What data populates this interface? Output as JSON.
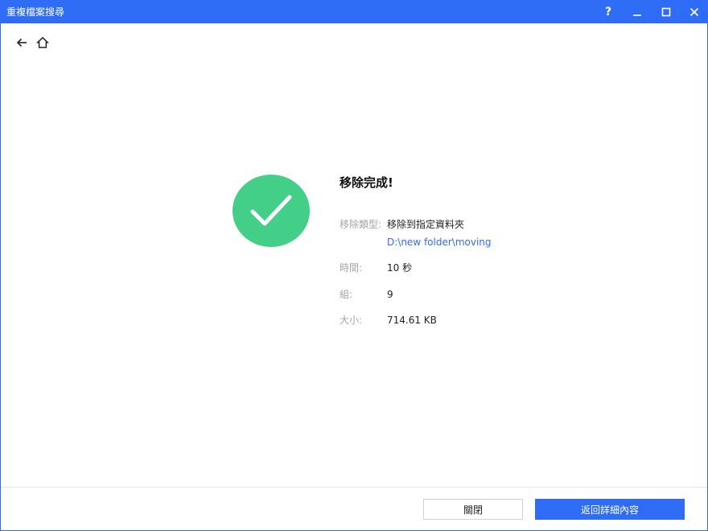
{
  "window": {
    "title": "重複檔案搜尋",
    "help_label": "?",
    "accent_color": "#2e6cf6"
  },
  "icons": {
    "back": "arrow-left-icon",
    "home": "home-icon",
    "success": "checkmark-icon",
    "minimize": "minimize-icon",
    "maximize": "maximize-icon",
    "close": "close-icon"
  },
  "result": {
    "heading": "移除完成!",
    "success_color": "#43cf87",
    "rows": {
      "type": {
        "label": "移除類型:",
        "value": "移除到指定資料夾"
      },
      "path": "D:\\new folder\\moving",
      "time": {
        "label": "時間:",
        "value": "10 秒"
      },
      "groups": {
        "label": "組:",
        "value": "9"
      },
      "size": {
        "label": "大小:",
        "value": "714.61 KB"
      }
    }
  },
  "footer": {
    "close_label": "關閉",
    "details_label": "返回詳細內容"
  }
}
